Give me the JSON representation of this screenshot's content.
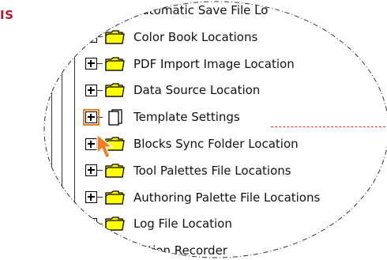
{
  "corner_label": "IS",
  "tree": {
    "items": [
      {
        "label": "Automatic Save File Lo",
        "icon": "folder-icon",
        "expander": "plus"
      },
      {
        "label": "Color Book Locations",
        "icon": "folder-icon",
        "expander": "plus"
      },
      {
        "label": "PDF Import Image Location",
        "icon": "folder-icon",
        "expander": "plus"
      },
      {
        "label": "Data Source Location",
        "icon": "folder-icon",
        "expander": "plus"
      },
      {
        "label": "Template Settings",
        "icon": "document-stack-icon",
        "expander": "plus",
        "highlighted": true
      },
      {
        "label": "Blocks Sync Folder Location",
        "icon": "folder-icon",
        "expander": "plus"
      },
      {
        "label": "Tool Palettes File Locations",
        "icon": "folder-icon",
        "expander": "plus"
      },
      {
        "label": "Authoring Palette File Locations",
        "icon": "folder-icon",
        "expander": "plus"
      },
      {
        "label": "Log File Location",
        "icon": "folder-icon",
        "expander": "plus"
      },
      {
        "label": "Action Recorder",
        "icon": "folder-icon",
        "expander": "plus"
      }
    ]
  },
  "colors": {
    "folder_fill": "#ffff00",
    "highlight": "#f07d1f",
    "callout_dash": "#e03030",
    "corner_label": "#c8102e"
  }
}
